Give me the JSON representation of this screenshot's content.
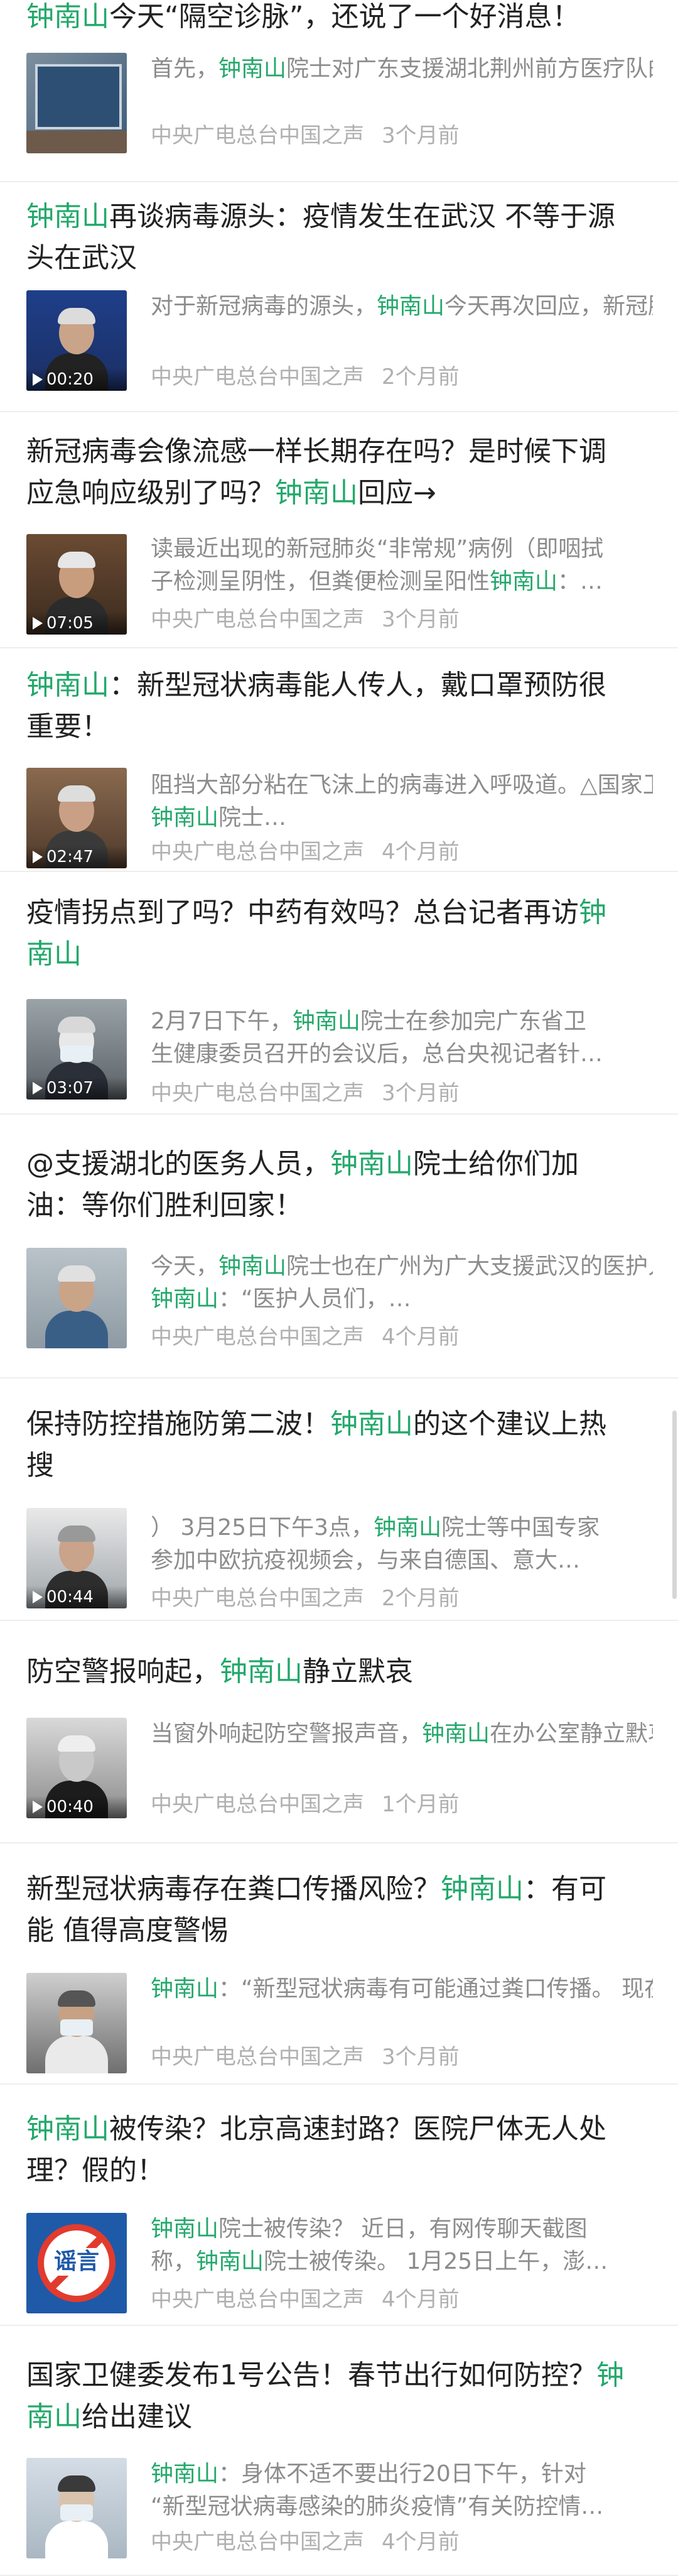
{
  "accent": "#23a86b",
  "articles": [
    {
      "title": [
        {
          "t": "钟南山",
          "h": true
        },
        {
          "t": "今天“隔空诊脉”，还说了一个好消息！"
        }
      ],
      "summary": [
        [
          "首先，",
          false
        ],
        [
          "钟南山",
          true
        ],
        [
          "院士对广东支援湖北荆州前方",
          false
        ],
        [
          "医疗队的工作给予了高度肯定，向大家表示…",
          false
        ]
      ],
      "source": "中央广电总台中国之声",
      "time": "3个月前",
      "duration": ""
    },
    {
      "title": [
        {
          "t": "钟南山",
          "h": true
        },
        {
          "t": "再谈病毒源头：疫情发生在武汉 不等于源"
        },
        {
          "t": "\n头在武汉"
        }
      ],
      "summary": [
        [
          "对于新冠病毒的源头，",
          false
        ],
        [
          "钟南山",
          true
        ],
        [
          "今天再次回",
          false
        ],
        [
          "应，新冠肺炎疫情先在中国武汉暴发，但这…",
          false
        ]
      ],
      "source": "中央广电总台中国之声",
      "time": "2个月前",
      "duration": "00:20"
    },
    {
      "title": [
        {
          "t": "新冠病毒会像流感一样长期存在吗？是时候下调"
        },
        {
          "t": "\n应急响应级别了吗？"
        },
        {
          "t": "钟南山",
          "h": true
        },
        {
          "t": "回应→"
        }
      ],
      "summary": [
        [
          "读最近出现的新冠肺炎“非常规”病例（即咽拭",
          false
        ],
        [
          "子检测呈阴性，但粪便检测呈阳性",
          false
        ],
        [
          "钟南山",
          true
        ],
        [
          "：…",
          false
        ]
      ],
      "source": "中央广电总台中国之声",
      "time": "3个月前",
      "duration": "07:05"
    },
    {
      "title": [
        {
          "t": "钟南山",
          "h": true
        },
        {
          "t": "：新型冠状病毒能人传人，戴口罩预防很"
        },
        {
          "t": "\n重要！"
        }
      ],
      "summary": [
        [
          "阻挡大部分粘在飞沫上的病毒进入呼吸道。",
          false
        ],
        [
          "△国家卫健委高级别专家组组长",
          false
        ],
        [
          "钟南山",
          true
        ],
        [
          "院士…",
          false
        ]
      ],
      "source": "中央广电总台中国之声",
      "time": "4个月前",
      "duration": "02:47"
    },
    {
      "title": [
        {
          "t": "疫情拐点到了吗？中药有效吗？总台记者再访"
        },
        {
          "t": "钟",
          "h": true
        },
        {
          "t": "\n南山",
          "h": true
        }
      ],
      "summary": [
        [
          "2月7日下午，",
          false
        ],
        [
          "钟南山",
          true
        ],
        [
          "院士在参加完广东省卫",
          false
        ],
        [
          "生健康委员召开的会议后，总台央视记者针…",
          false
        ]
      ],
      "source": "中央广电总台中国之声",
      "time": "3个月前",
      "duration": "03:07"
    },
    {
      "title": [
        {
          "t": "@支援湖北的医务人员，"
        },
        {
          "t": "钟南山",
          "h": true
        },
        {
          "t": "院士给你们加"
        },
        {
          "t": "\n油：等你们胜利回家！"
        }
      ],
      "summary": [
        [
          "今天，",
          false
        ],
        [
          "钟南山",
          true
        ],
        [
          "院士也在广州为广大支援武汉",
          false
        ],
        [
          "的医护人员加油。 ",
          false
        ],
        [
          "钟南山",
          true
        ],
        [
          "：“医护人员们，…",
          false
        ]
      ],
      "source": "中央广电总台中国之声",
      "time": "4个月前",
      "duration": ""
    },
    {
      "title": [
        {
          "t": "保持防控措施防第二波！"
        },
        {
          "t": "钟南山",
          "h": true
        },
        {
          "t": "的这个建议上热"
        },
        {
          "t": "\n搜"
        }
      ],
      "summary": [
        [
          "） 3月25日下午3点，",
          false
        ],
        [
          "钟南山",
          true
        ],
        [
          "院士等中国专家",
          false
        ],
        [
          "参加中欧抗疫视频会，与来自德国、意大…",
          false
        ]
      ],
      "source": "中央广电总台中国之声",
      "time": "2个月前",
      "duration": "00:44"
    },
    {
      "title": [
        {
          "t": "防空警报响起，"
        },
        {
          "t": "钟南山",
          "h": true
        },
        {
          "t": "静立默哀"
        }
      ],
      "summary": [
        [
          "当窗外响起防空警报声音，",
          false
        ],
        [
          "钟南山",
          true
        ],
        [
          "在办公室",
          false
        ],
        [
          "静立默哀，向抗击新冠肺炎疫情斗争牺牲烈…",
          false
        ]
      ],
      "source": "中央广电总台中国之声",
      "time": "1个月前",
      "duration": "00:40"
    },
    {
      "title": [
        {
          "t": "新型冠状病毒存在粪口传播风险？"
        },
        {
          "t": "钟南山",
          "h": true
        },
        {
          "t": "：有可"
        },
        {
          "t": "\n能 值得高度警惕"
        }
      ],
      "summary": [
        [
          "钟南山",
          true
        ],
        [
          "：“新型冠状病毒有可能通过粪口传",
          false
        ],
        [
          "播。 现在这个问题应该非常重视，因为在…",
          false
        ]
      ],
      "source": "中央广电总台中国之声",
      "time": "3个月前",
      "duration": ""
    },
    {
      "title": [
        {
          "t": "钟南山",
          "h": true
        },
        {
          "t": "被传染？北京高速封路？医院尸体无人处"
        },
        {
          "t": "\n理？假的！"
        }
      ],
      "summary": [
        [
          "钟南山",
          true
        ],
        [
          "院士被传染？ 近日，有网传聊天截图",
          false
        ],
        [
          "称，",
          false
        ],
        [
          "钟南山",
          true
        ],
        [
          "院士被传染。 1月25日上午，澎…",
          false
        ]
      ],
      "source": "中央广电总台中国之声",
      "time": "4个月前",
      "duration": "",
      "badge": "谣言"
    },
    {
      "title": [
        {
          "t": "国家卫健委发布1号公告！春节出行如何防控？"
        },
        {
          "t": "钟",
          "h": true
        },
        {
          "t": "\n南山",
          "h": true
        },
        {
          "t": "给出建议"
        }
      ],
      "summary": [
        [
          "钟南山",
          true
        ],
        [
          "：身体不适不要出行20日下午，针对",
          false
        ],
        [
          "“新型冠状病毒感染的肺炎疫情”有关防控情…",
          false
        ]
      ],
      "source": "中央广电总台中国之声",
      "time": "4个月前",
      "duration": ""
    }
  ]
}
